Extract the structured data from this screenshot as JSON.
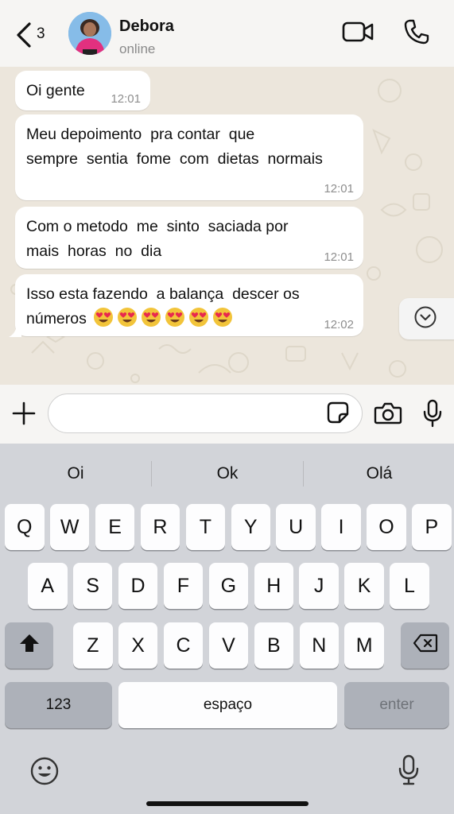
{
  "header": {
    "back_count": "3",
    "contact_name": "Debora",
    "contact_status": "online",
    "icons": [
      "chevron-left-icon",
      "video-call-icon",
      "phone-icon"
    ]
  },
  "messages": [
    {
      "text": "Oi gente",
      "time": "12:01",
      "emojis": ""
    },
    {
      "text": "Meu depoimento  pra contar  que\nsempre  sentia  fome  com  dietas  normais",
      "time": "12:01",
      "emojis": ""
    },
    {
      "text": "Com o metodo  me  sinto  saciada por\nmais  horas  no  dia",
      "time": "12:01",
      "emojis": ""
    },
    {
      "text": "Isso esta fazendo  a balança  descer os\nnúmeros",
      "time": "12:02",
      "emojis": "😍😍😍😍😍😍"
    }
  ],
  "composer": {
    "placeholder": "",
    "icons": [
      "plus-icon",
      "sticker-icon",
      "camera-icon",
      "microphone-icon"
    ]
  },
  "keyboard": {
    "suggestions": [
      "Oi",
      "Ok",
      "Olá"
    ],
    "row1": [
      "Q",
      "W",
      "E",
      "R",
      "T",
      "Y",
      "U",
      "I",
      "O",
      "P"
    ],
    "row2": [
      "A",
      "S",
      "D",
      "F",
      "G",
      "H",
      "J",
      "K",
      "L"
    ],
    "row3": [
      "Z",
      "X",
      "C",
      "V",
      "B",
      "N",
      "M"
    ],
    "numbers_label": "123",
    "space_label": "espaço",
    "enter_label": "enter"
  },
  "colors": {
    "chat_background": "#ece6dc",
    "bubble_incoming": "#ffffff",
    "keyboard_background": "#d2d4d9",
    "heart_eyes_face": "#f2c43a"
  }
}
